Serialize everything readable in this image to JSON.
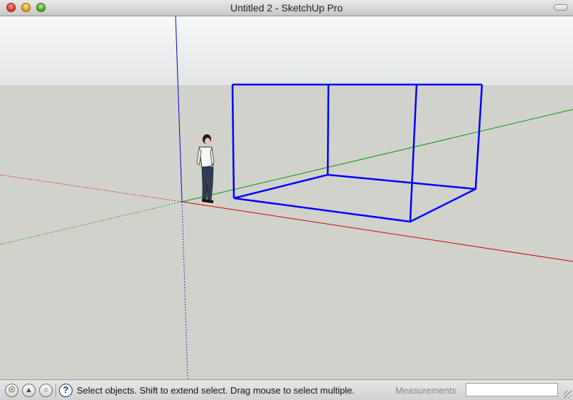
{
  "window": {
    "title": "Untitled 2 - SketchUp Pro",
    "controls": [
      "close-icon",
      "minimize-icon",
      "zoom-icon"
    ]
  },
  "viewport": {
    "sky_color": "#e9eced",
    "ground_color": "#d2d2cd",
    "axis_colors": {
      "red": "#cc0000",
      "green": "#009900",
      "blue": "#0000cc"
    },
    "selection_color": "#0000ff"
  },
  "status": {
    "icons": [
      "lightbulb-icon",
      "person-icon",
      "g-circle-icon",
      "help-icon"
    ],
    "help_glyph": "?",
    "message": "Select objects. Shift to extend select. Drag mouse to select multiple.",
    "measurements_label": "Measurements",
    "measurements_value": ""
  }
}
